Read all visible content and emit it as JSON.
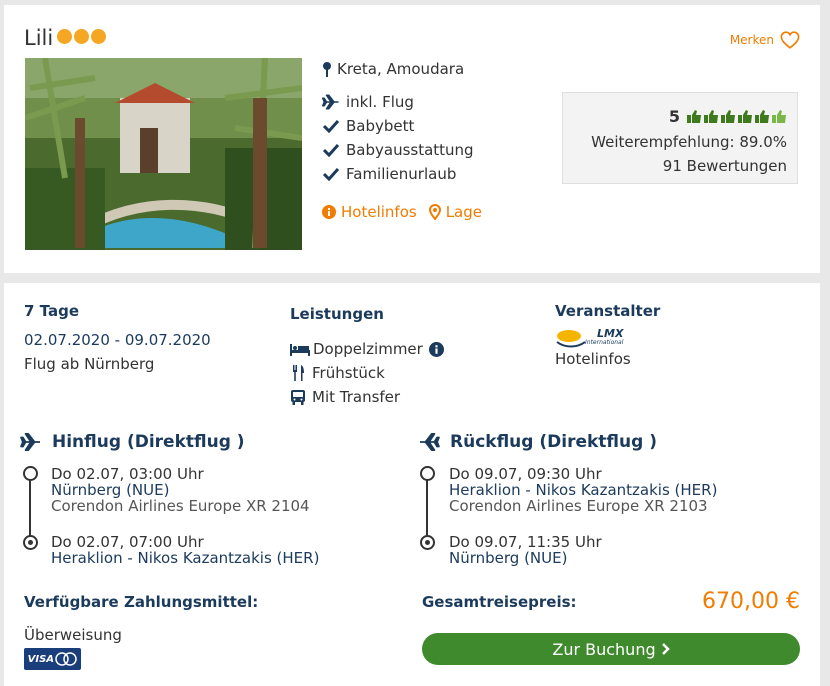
{
  "hotel": {
    "name": "Lili",
    "star_count": 3,
    "merken_label": "Merken",
    "location": "Kreta, Amoudara",
    "features": [
      "inkl. Flug",
      "Babybett",
      "Babyausstattung",
      "Familienurlaub"
    ],
    "links": {
      "hotelinfos": "Hotelinfos",
      "lage": "Lage"
    }
  },
  "rating": {
    "score": "5",
    "thumbs": 6,
    "recommendation": "Weiterempfehlung: 89.0%",
    "reviews": "91 Bewertungen"
  },
  "trip": {
    "duration": "7 Tage",
    "dates": "02.07.2020 - 09.07.2020",
    "departure": "Flug ab Nürnberg"
  },
  "services": {
    "title": "Leistungen",
    "room": "Doppelzimmer",
    "board": "Frühstück",
    "transfer": "Mit Transfer"
  },
  "operator": {
    "title": "Veranstalter",
    "logo_text": "LMX",
    "logo_sub": "International",
    "hotelinfos": "Hotelinfos"
  },
  "outbound": {
    "title": "Hinflug (Direktflug )",
    "dep_time": "Do 02.07, 03:00 Uhr",
    "dep_airport": "Nürnberg (NUE)",
    "flight": "Corendon Airlines Europe XR 2104",
    "arr_time": "Do 02.07, 07:00 Uhr",
    "arr_airport": "Heraklion - Nikos Kazantzakis (HER)"
  },
  "return": {
    "title": "Rückflug (Direktflug )",
    "dep_time": "Do 09.07, 09:30 Uhr",
    "dep_airport": "Heraklion - Nikos Kazantzakis (HER)",
    "flight": "Corendon Airlines Europe XR 2103",
    "arr_time": "Do 09.07, 11:35 Uhr",
    "arr_airport": "Nürnberg (NUE)"
  },
  "payment": {
    "title": "Verfügbare Zahlungsmittel:",
    "method": "Überweisung",
    "card_logo_text": "VISA"
  },
  "price": {
    "label": "Gesamtreisepreis:",
    "value": "670,00 €"
  },
  "booking": {
    "label": "Zur Buchung"
  },
  "colors": {
    "accent": "#f07c00",
    "navy": "#1b3a5c",
    "button": "#3f8a2c",
    "star": "#f5a623"
  }
}
